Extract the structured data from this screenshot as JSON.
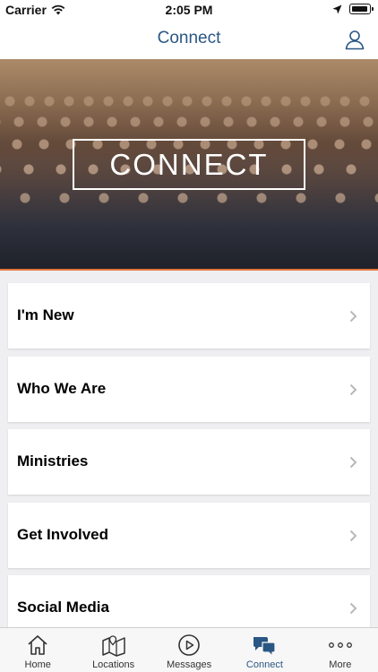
{
  "status_bar": {
    "carrier": "Carrier",
    "time": "2:05 PM"
  },
  "nav": {
    "title": "Connect",
    "profile_icon": "person-outline-icon"
  },
  "hero": {
    "overlay_text": "CONNECT",
    "accent_color": "#e2773a"
  },
  "list": {
    "items": [
      {
        "label": "I'm New"
      },
      {
        "label": "Who We Are"
      },
      {
        "label": "Ministries"
      },
      {
        "label": "Get Involved"
      },
      {
        "label": "Social Media"
      }
    ]
  },
  "tab_bar": {
    "active_color": "#2a5784",
    "tabs": [
      {
        "label": "Home",
        "icon": "house-icon"
      },
      {
        "label": "Locations",
        "icon": "map-icon"
      },
      {
        "label": "Messages",
        "icon": "play-circle-icon"
      },
      {
        "label": "Connect",
        "icon": "chat-bubbles-icon",
        "active": true
      },
      {
        "label": "More",
        "icon": "more-dots-icon"
      }
    ]
  }
}
